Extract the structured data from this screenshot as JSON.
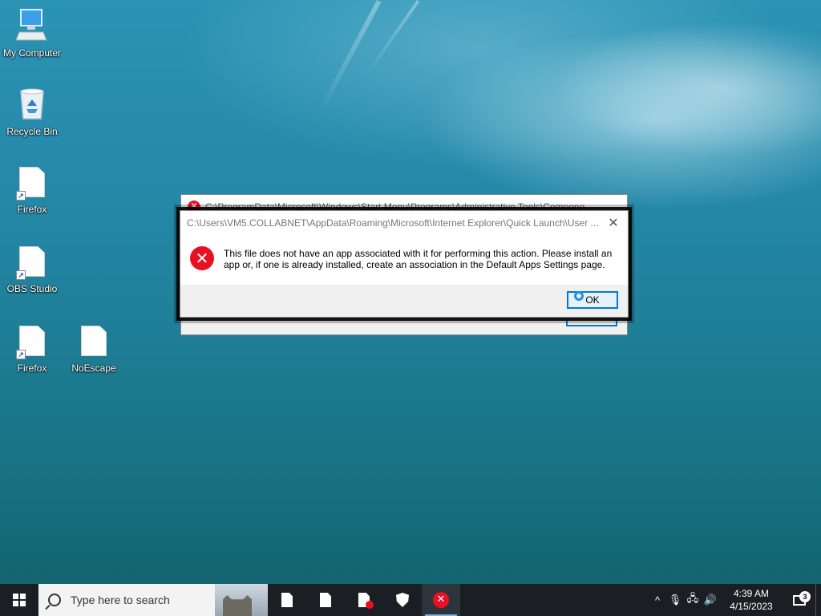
{
  "desktop": {
    "icons": [
      {
        "label": "My Computer",
        "icon": "computer-icon"
      },
      {
        "label": "Recycle Bin",
        "icon": "recycle-bin-icon"
      },
      {
        "label": "Firefox",
        "icon": "file-shortcut-icon"
      },
      {
        "label": "OBS Studio",
        "icon": "file-shortcut-icon"
      },
      {
        "label": "Firefox",
        "icon": "file-shortcut-icon"
      },
      {
        "label": "NoEscape",
        "icon": "file-icon"
      }
    ]
  },
  "dialog_back": {
    "title": "C:\\ProgramData\\Microsoft\\Windows\\Start Menu\\Programs\\Administrative Tools\\Compone..."
  },
  "dialog": {
    "title": "C:\\Users\\VM5.COLLABNET\\AppData\\Roaming\\Microsoft\\Internet Explorer\\Quick Launch\\User ...",
    "close_label": "✕",
    "message": "This file does not have an app associated with it for performing this action. Please install an app or, if one is already installed, create an association in the Default Apps Settings page.",
    "ok_label": "OK",
    "error_glyph": "✕"
  },
  "taskbar": {
    "search_placeholder": "Type here to search",
    "tray": {
      "chevron": "^",
      "mic": "🎙",
      "network": "🖧",
      "volume": "🔊",
      "time": "4:39 AM",
      "date": "4/15/2023",
      "notification_count": "3"
    }
  },
  "colors": {
    "accent": "#0078d7",
    "error": "#e81123",
    "taskbar": "#1b1f24"
  }
}
